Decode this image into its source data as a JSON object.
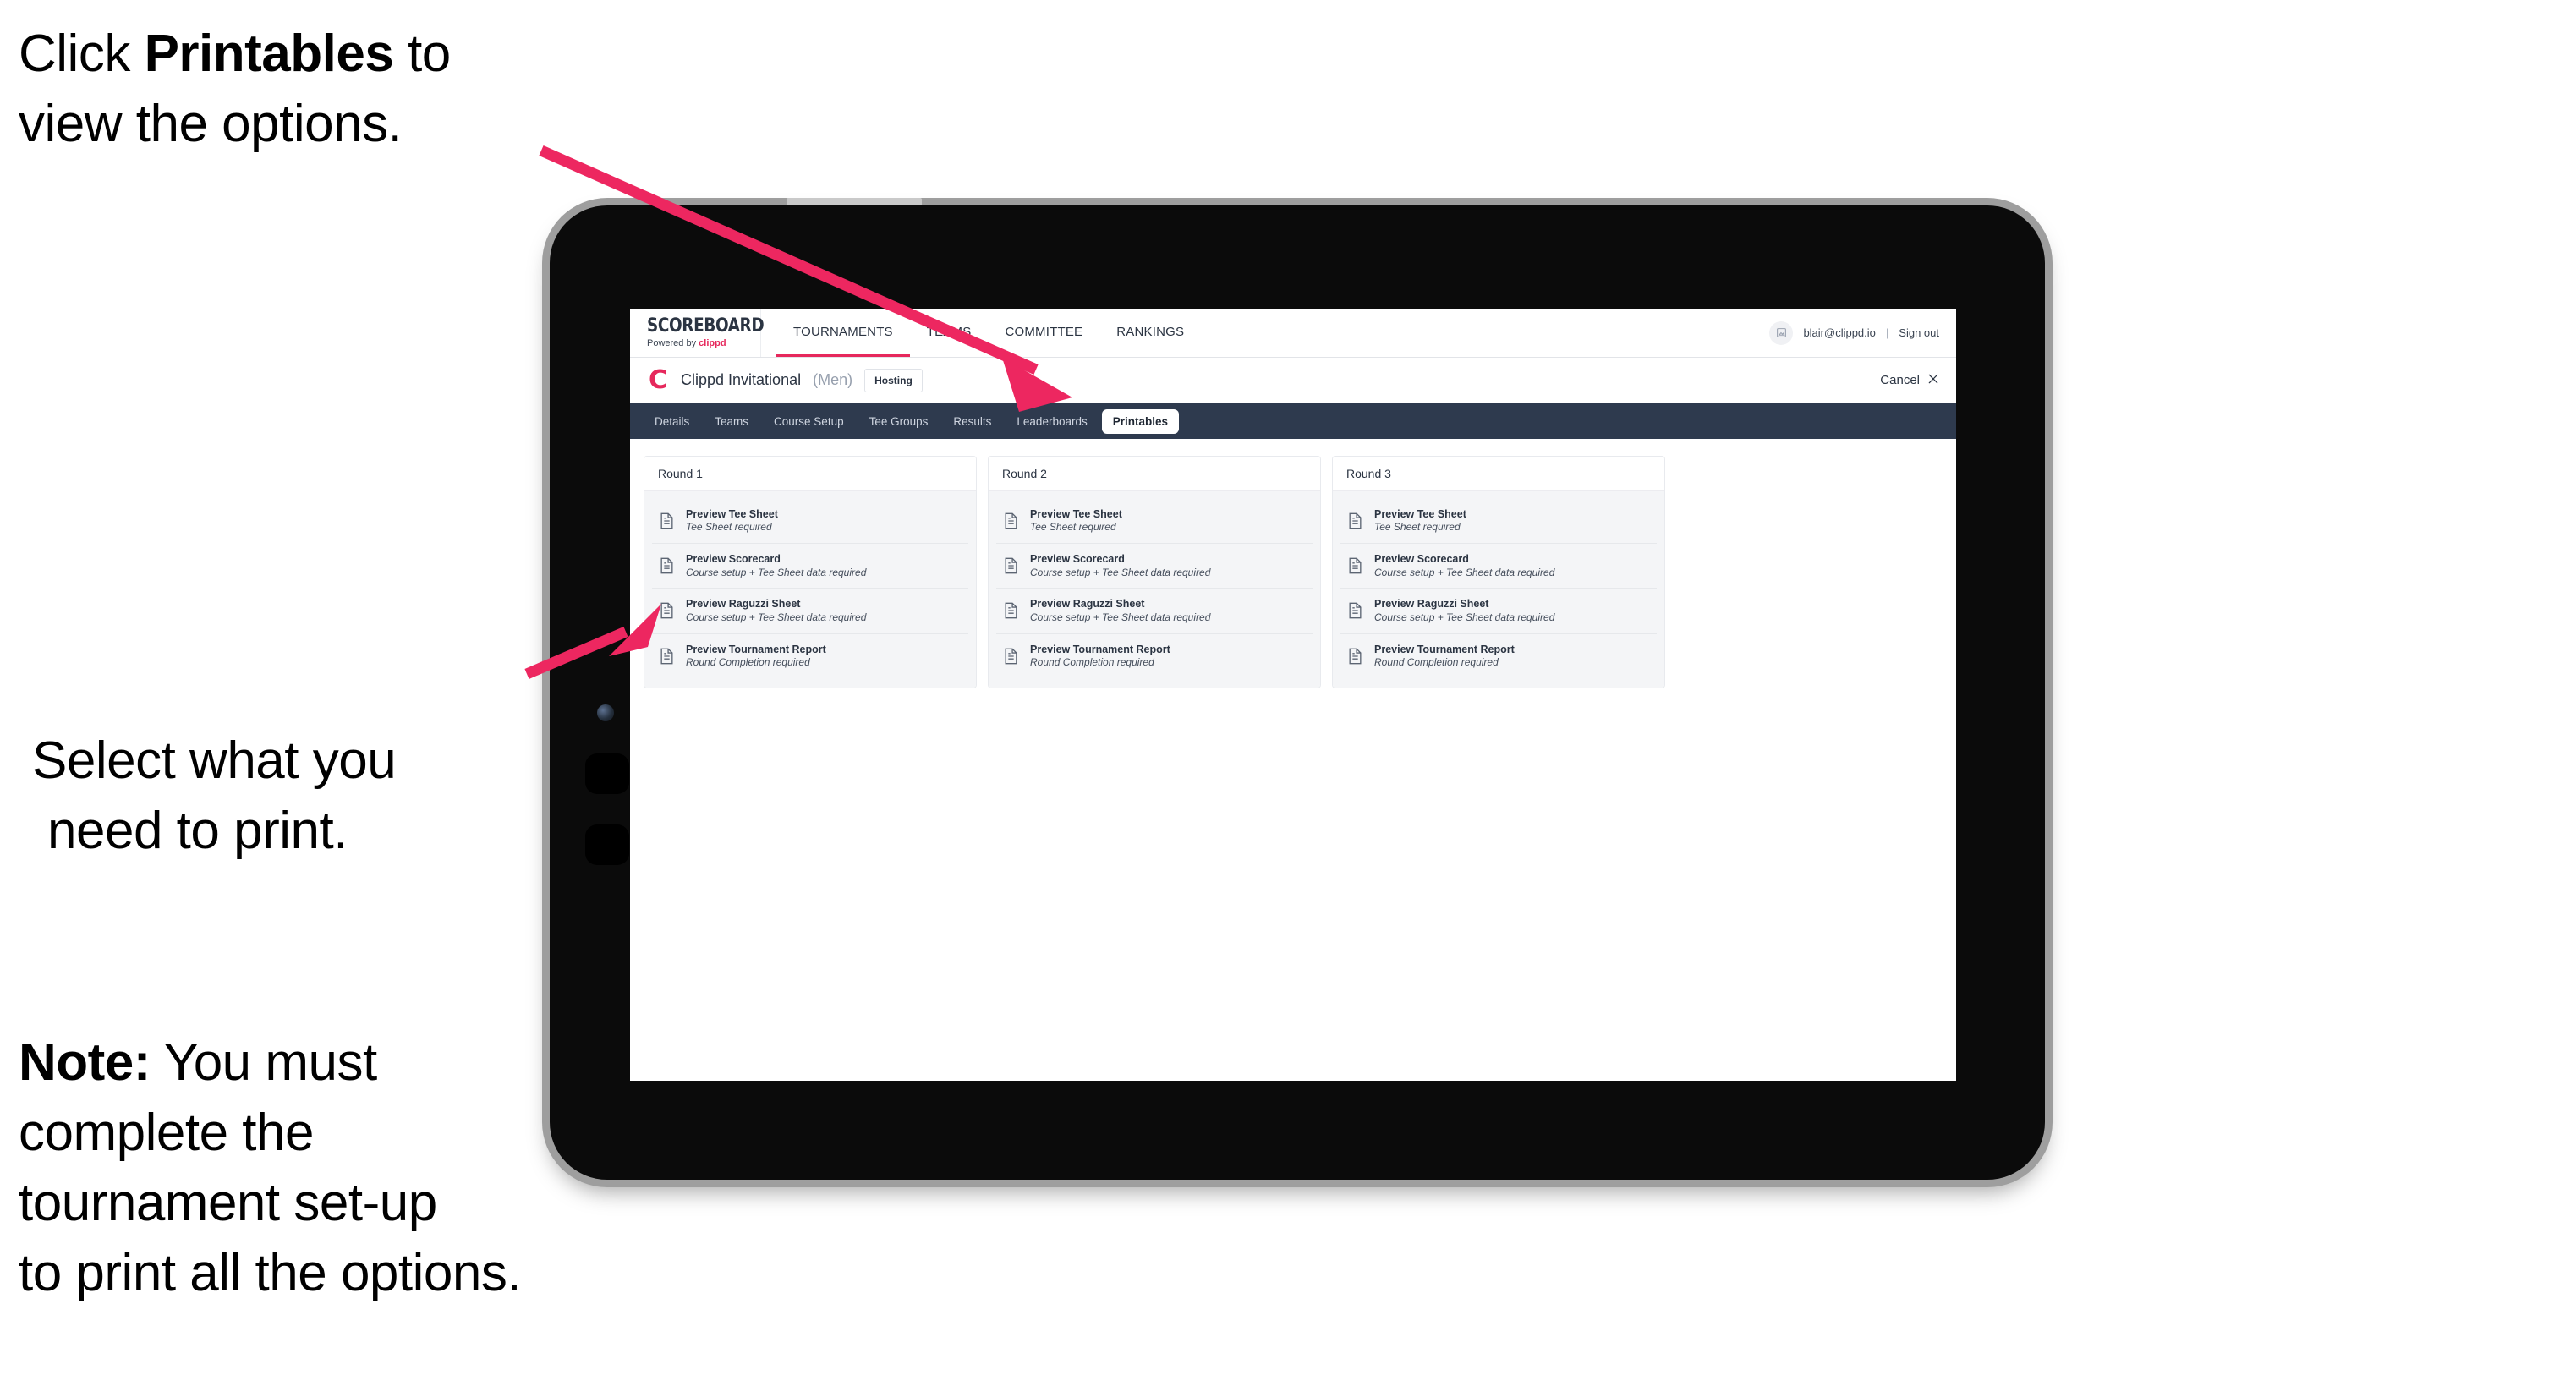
{
  "annotations": {
    "a1_pre": "Click ",
    "a1_bold": "Printables",
    "a1_post": " to\nview the options.",
    "a2_line1": "Select what you",
    "a2_line2": "need to print.",
    "a3_bold": "Note:",
    "a3_rest": " You must\ncomplete the\ntournament set-up\nto print all the options."
  },
  "colors": {
    "arrow_pink": "#ED2760",
    "accent_pink": "#e6285c",
    "tab_bar": "#2e3a4e",
    "tablet_body": "#0b0b0b",
    "tablet_bezel": "#9e9e9e"
  },
  "browser": {
    "brand": {
      "title": "SCOREBOARD",
      "sub_prefix": "Powered by ",
      "sub_brand": "clippd"
    },
    "main_nav": [
      {
        "label": "TOURNAMENTS",
        "active": true
      },
      {
        "label": "TEAMS",
        "active": false
      },
      {
        "label": "COMMITTEE",
        "active": false
      },
      {
        "label": "RANKINGS",
        "active": false
      }
    ],
    "account": {
      "avatar_icon": "user-avatar-icon",
      "email": "blair@clippd.io",
      "separator": "|",
      "sign_out": "Sign out"
    },
    "tournament_bar": {
      "logo_glyph": "C",
      "name": "Clippd Invitational",
      "gender": "(Men)",
      "badge": "Hosting",
      "cancel_label": "Cancel",
      "cancel_icon": "close-x-icon"
    },
    "tabs": [
      {
        "label": "Details",
        "active": false
      },
      {
        "label": "Teams",
        "active": false
      },
      {
        "label": "Course Setup",
        "active": false
      },
      {
        "label": "Tee Groups",
        "active": false
      },
      {
        "label": "Results",
        "active": false
      },
      {
        "label": "Leaderboards",
        "active": false
      },
      {
        "label": "Printables",
        "active": true
      }
    ],
    "rounds": [
      {
        "title": "Round 1",
        "items": [
          {
            "title": "Preview Tee Sheet",
            "sub": "Tee Sheet required",
            "icon": "document-icon"
          },
          {
            "title": "Preview Scorecard",
            "sub": "Course setup + Tee Sheet data required",
            "icon": "document-icon"
          },
          {
            "title": "Preview Raguzzi Sheet",
            "sub": "Course setup + Tee Sheet data required",
            "icon": "document-icon"
          },
          {
            "title": "Preview Tournament Report",
            "sub": "Round Completion required",
            "icon": "document-icon"
          }
        ]
      },
      {
        "title": "Round 2",
        "items": [
          {
            "title": "Preview Tee Sheet",
            "sub": "Tee Sheet required",
            "icon": "document-icon"
          },
          {
            "title": "Preview Scorecard",
            "sub": "Course setup + Tee Sheet data required",
            "icon": "document-icon"
          },
          {
            "title": "Preview Raguzzi Sheet",
            "sub": "Course setup + Tee Sheet data required",
            "icon": "document-icon"
          },
          {
            "title": "Preview Tournament Report",
            "sub": "Round Completion required",
            "icon": "document-icon"
          }
        ]
      },
      {
        "title": "Round 3",
        "items": [
          {
            "title": "Preview Tee Sheet",
            "sub": "Tee Sheet required",
            "icon": "document-icon"
          },
          {
            "title": "Preview Scorecard",
            "sub": "Course setup + Tee Sheet data required",
            "icon": "document-icon"
          },
          {
            "title": "Preview Raguzzi Sheet",
            "sub": "Course setup + Tee Sheet data required",
            "icon": "document-icon"
          },
          {
            "title": "Preview Tournament Report",
            "sub": "Round Completion required",
            "icon": "document-icon"
          }
        ]
      }
    ]
  }
}
